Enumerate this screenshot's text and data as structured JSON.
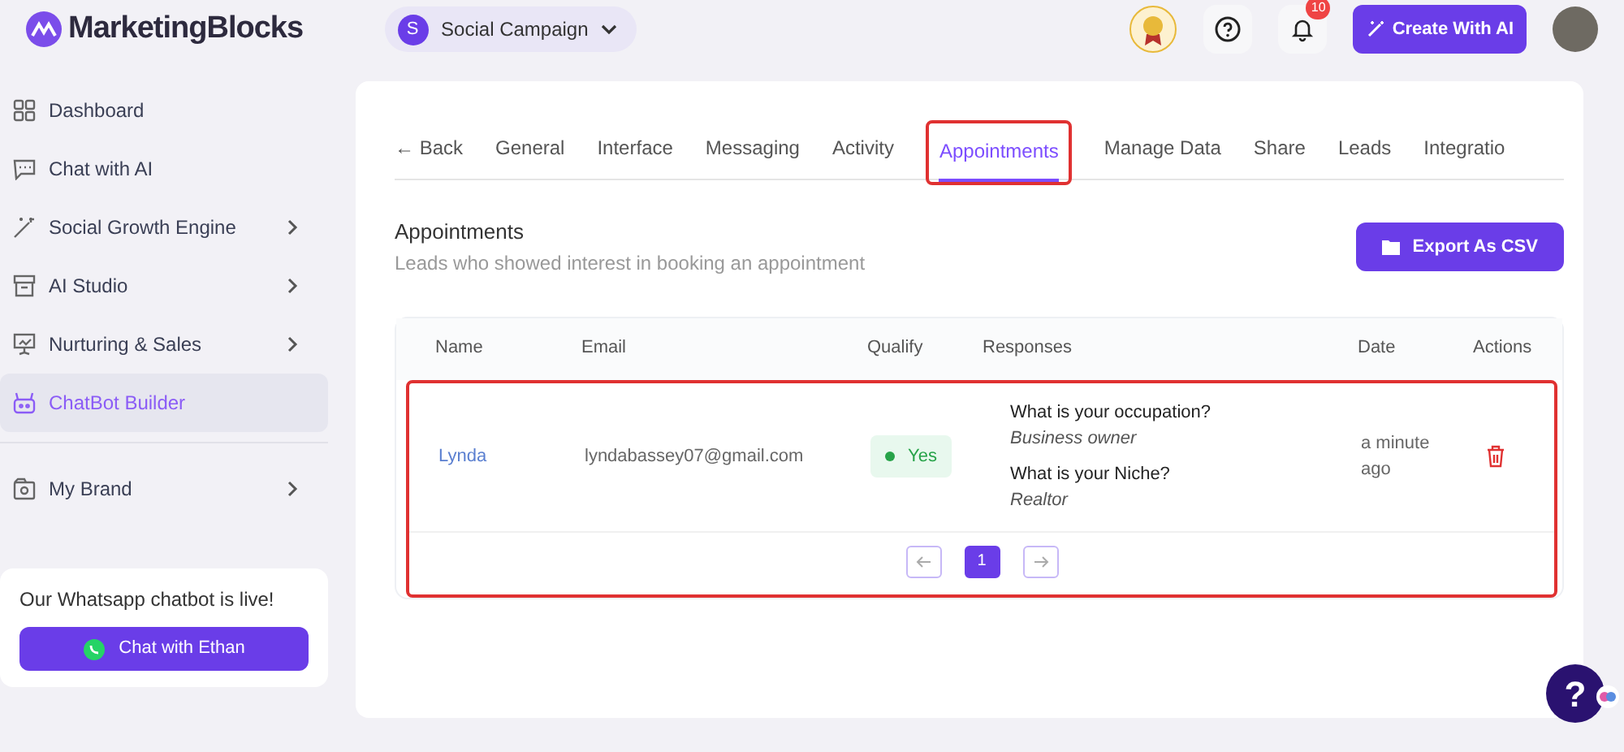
{
  "brand": {
    "name": "MarketingBlocks"
  },
  "workspace": {
    "initial": "S",
    "name": "Social Campaign"
  },
  "header": {
    "notifications": "10",
    "create_button": "Create With AI"
  },
  "sidebar": {
    "items": [
      {
        "label": "Dashboard",
        "has_submenu": false,
        "selected": false
      },
      {
        "label": "Chat with AI",
        "has_submenu": false,
        "selected": false
      },
      {
        "label": "Social Growth Engine",
        "has_submenu": true,
        "selected": false
      },
      {
        "label": "AI Studio",
        "has_submenu": true,
        "selected": false
      },
      {
        "label": "Nurturing & Sales",
        "has_submenu": true,
        "selected": false
      },
      {
        "label": "ChatBot Builder",
        "has_submenu": false,
        "selected": true
      }
    ],
    "bottom_items": [
      {
        "label": "My Brand",
        "has_submenu": true,
        "selected": false
      }
    ],
    "promo": {
      "text": "Our Whatsapp chatbot is live!",
      "button": "Chat with Ethan"
    }
  },
  "back": "← Back",
  "tabs": [
    {
      "label": "General",
      "selected": false,
      "highlighted": false
    },
    {
      "label": "Interface",
      "selected": false,
      "highlighted": false
    },
    {
      "label": "Messaging",
      "selected": false,
      "highlighted": false
    },
    {
      "label": "Activity",
      "selected": false,
      "highlighted": false
    },
    {
      "label": "Appointments",
      "selected": true,
      "highlighted": true
    },
    {
      "label": "Manage Data",
      "selected": false,
      "highlighted": false
    },
    {
      "label": "Share",
      "selected": false,
      "highlighted": false
    },
    {
      "label": "Leads",
      "selected": false,
      "highlighted": false
    },
    {
      "label": "Integratio",
      "selected": false,
      "highlighted": false
    }
  ],
  "section": {
    "title": "Appointments",
    "subtitle": "Leads who showed interest in booking an appointment",
    "export_button": "Export As CSV"
  },
  "table": {
    "columns": [
      "Name",
      "Email",
      "Qualify",
      "Responses",
      "Date",
      "Actions"
    ],
    "highlighted": true,
    "rows": [
      {
        "name": "Lynda",
        "email": "lyndabassey07@gmail.com",
        "qualify": "Yes",
        "qualified": true,
        "responses": [
          {
            "question": "What is your occupation?",
            "answer": "Business owner"
          },
          {
            "question": "What is your Niche?",
            "answer": "Realtor"
          }
        ],
        "date": "a minute ago"
      }
    ]
  },
  "pagination": {
    "pages": [
      {
        "label": "1",
        "selected": true
      }
    ]
  },
  "help_button": "?"
}
